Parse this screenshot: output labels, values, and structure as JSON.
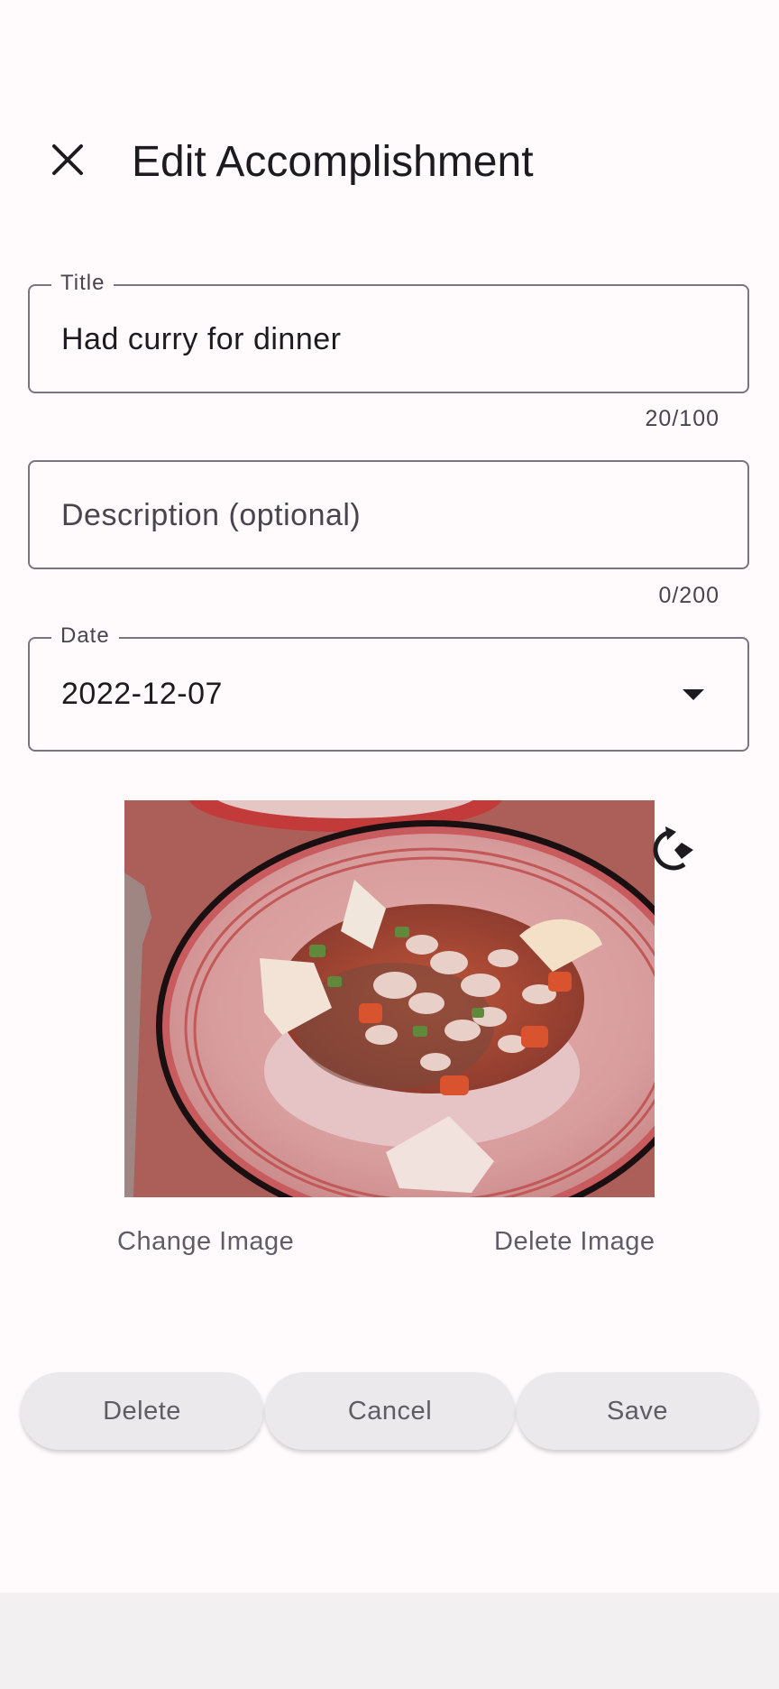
{
  "header": {
    "title": "Edit Accomplishment",
    "close_icon": "close-icon"
  },
  "form": {
    "title_field": {
      "label": "Title",
      "value": "Had curry for dinner",
      "counter": "20/100"
    },
    "description_field": {
      "placeholder": "Description (optional)",
      "value": "",
      "counter": "0/200"
    },
    "date_field": {
      "label": "Date",
      "value": "2022-12-07",
      "dropdown_icon": "arrow-drop-down-icon"
    }
  },
  "image": {
    "rotate_icon": "rotate-icon",
    "change_label": "Change Image",
    "delete_label": "Delete Image"
  },
  "actions": {
    "delete_label": "Delete",
    "cancel_label": "Cancel",
    "save_label": "Save"
  }
}
